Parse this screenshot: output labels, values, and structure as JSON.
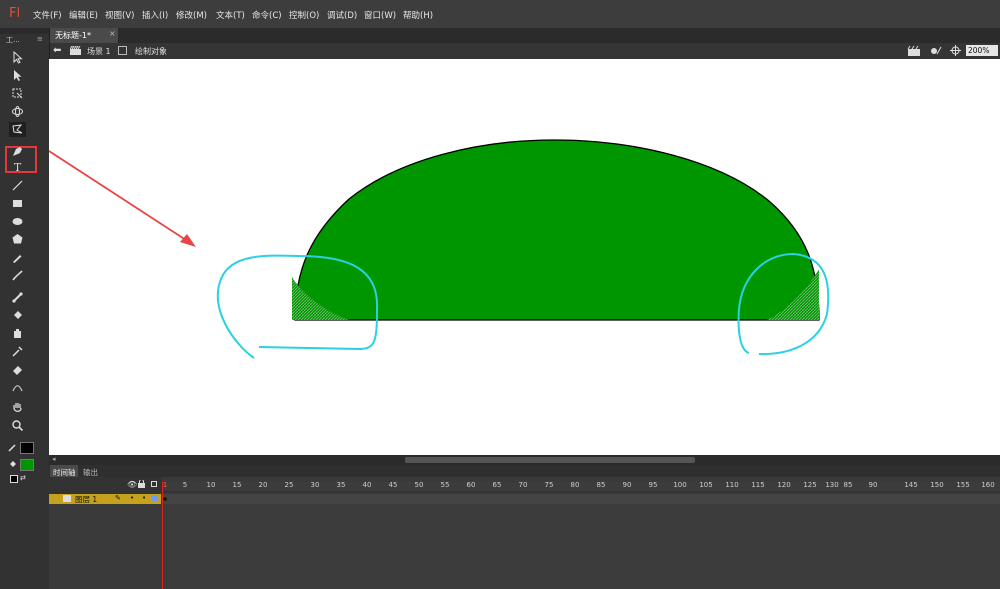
{
  "app": {
    "logo": "Fl"
  },
  "menu": [
    "文件(F)",
    "编辑(E)",
    "视图(V)",
    "插入(I)",
    "修改(M)",
    "文本(T)",
    "命令(C)",
    "控制(O)",
    "调试(D)",
    "窗口(W)",
    "帮助(H)"
  ],
  "document": {
    "tab_title": "无标题-1*",
    "tab_close": "×"
  },
  "editbar": {
    "scene": "场景 1",
    "object": "绘制对象",
    "zoom": "200%"
  },
  "timeline": {
    "tabs": [
      "时间轴",
      "输出"
    ],
    "layer_name": "图层 1",
    "frame_numbers": [
      "1",
      "5",
      "10",
      "15",
      "20",
      "25",
      "30",
      "35",
      "40",
      "45",
      "50",
      "55",
      "60",
      "65",
      "70",
      "75",
      "80",
      "85",
      "90",
      "95",
      "100",
      "105",
      "110",
      "115",
      "120",
      "125",
      "130",
      "85",
      "90",
      "145",
      "150",
      "155",
      "160"
    ]
  },
  "toolbar": {
    "panel_label": "工..."
  },
  "colors": {
    "stroke": "#000000",
    "fill": "#009600",
    "highlight": "#e5383b",
    "annotation": "#2ad1e3",
    "arrow": "#ea4444"
  }
}
